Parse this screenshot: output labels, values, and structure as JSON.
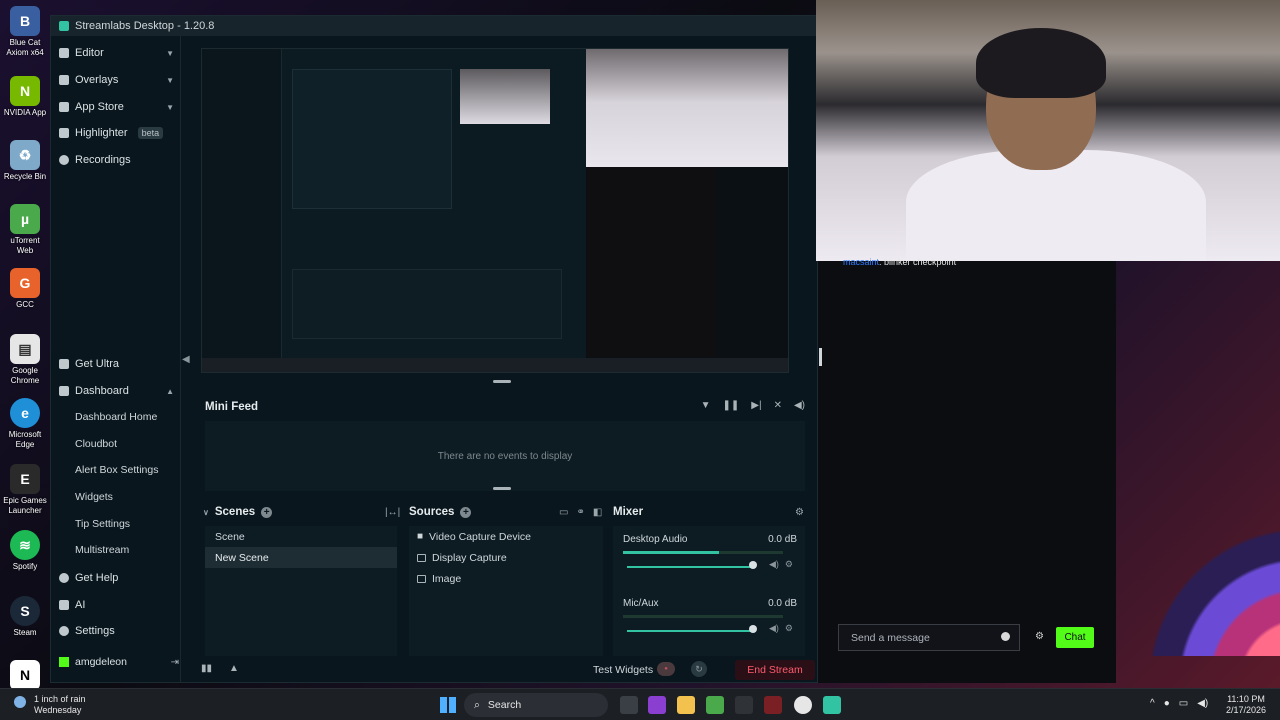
{
  "window": {
    "title": "Streamlabs Desktop - 1.20.8"
  },
  "desktop_icons": [
    {
      "label": "Blue Cat Axiom x64",
      "color": "#3a5fa0"
    },
    {
      "label": "NVIDIA App",
      "color": "#76b900"
    },
    {
      "label": "Recycle Bin",
      "color": "#7fa9c9"
    },
    {
      "label": "uTorrent Web",
      "color": "#4aa94a"
    },
    {
      "label": "GCC",
      "color": "#e8632b"
    },
    {
      "label": "Google Chrome",
      "color": "#e6e6e6"
    },
    {
      "label": "Microsoft Edge",
      "color": "#1f8fd8"
    },
    {
      "label": "Epic Games Launcher",
      "color": "#2a2a2a"
    },
    {
      "label": "Spotify",
      "color": "#1db954"
    },
    {
      "label": "Steam",
      "color": "#1b2838"
    }
  ],
  "sidebar": {
    "top": [
      {
        "label": "Editor"
      },
      {
        "label": "Overlays"
      },
      {
        "label": "App Store"
      },
      {
        "label": "Highlighter",
        "badge": "beta"
      },
      {
        "label": "Recordings"
      }
    ],
    "get_ultra": "Get Ultra",
    "dashboard": {
      "label": "Dashboard",
      "items": [
        "Dashboard Home",
        "Cloudbot",
        "Alert Box Settings",
        "Widgets",
        "Tip Settings",
        "Multistream"
      ]
    },
    "get_help": "Get Help",
    "ai": "AI",
    "settings": "Settings",
    "username": "amgdeleon"
  },
  "mini_feed": {
    "title": "Mini Feed",
    "empty_text": "There are no events to display"
  },
  "scenes": {
    "title": "Scenes",
    "items": [
      {
        "name": "Scene",
        "selected": false
      },
      {
        "name": "New Scene",
        "selected": true
      }
    ]
  },
  "sources": {
    "title": "Sources",
    "items": [
      "Video Capture Device",
      "Display Capture",
      "Image"
    ]
  },
  "mixer": {
    "title": "Mixer",
    "channels": [
      {
        "name": "Desktop Audio",
        "db": "0.0 dB",
        "level": 0.6
      },
      {
        "name": "Mic/Aux",
        "db": "0.0 dB",
        "level": 0.0
      }
    ]
  },
  "footer": {
    "test_widgets": "Test Widgets",
    "end_stream": "End Stream"
  },
  "chat": {
    "nick": "macsaint",
    "message": "blinker checkpoint",
    "placeholder": "Send a message",
    "button": "Chat"
  },
  "taskbar": {
    "weather_line1": "1 inch of rain",
    "weather_line2": "Wednesday",
    "search_label": "Search",
    "time": "11:10 PM",
    "date": "2/17/2026"
  }
}
